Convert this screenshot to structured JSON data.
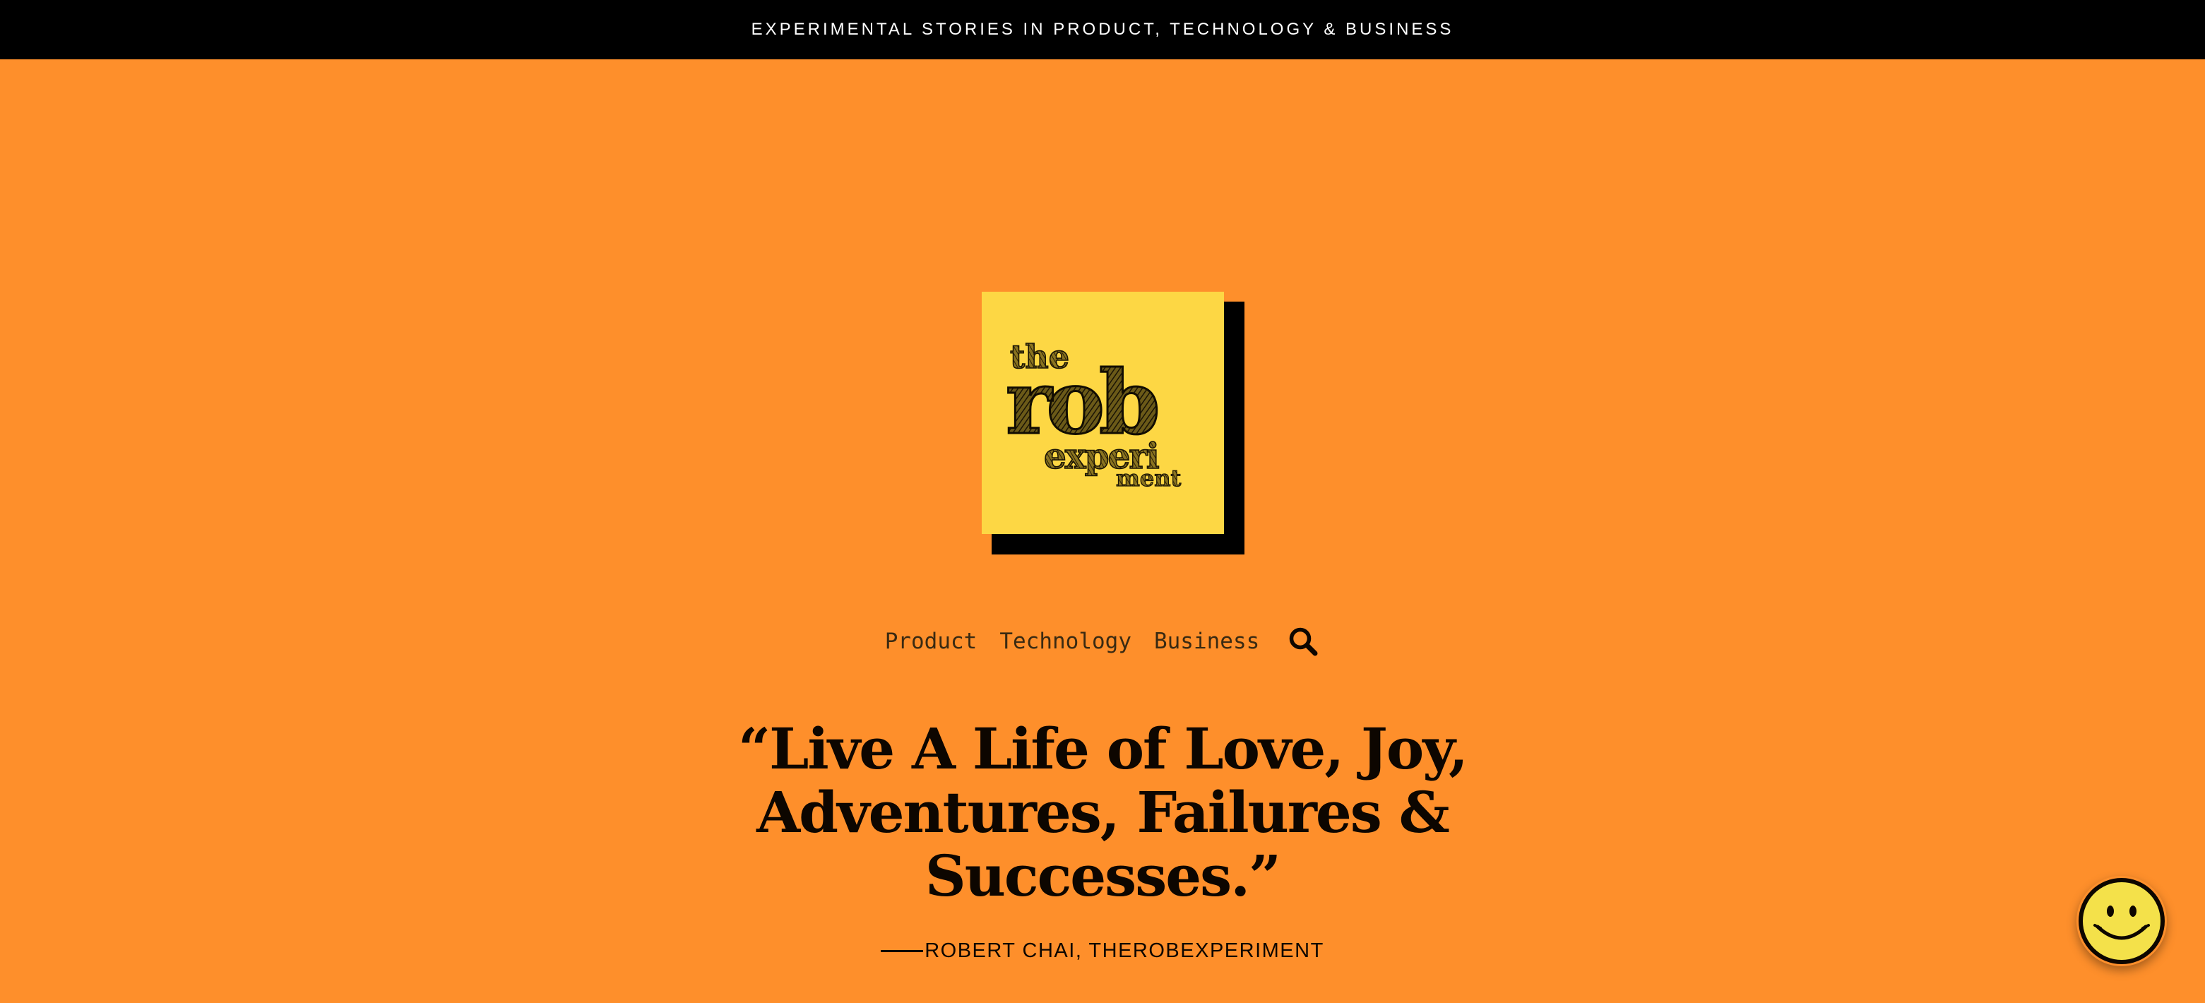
{
  "topbar": {
    "tagline": "EXPERIMENTAL STORIES IN PRODUCT, TECHNOLOGY & BUSINESS"
  },
  "logo": {
    "line1": "the",
    "line2": "rob",
    "line3": "experi",
    "line4": "ment",
    "background_color": "#fdd744",
    "shadow_color": "#000000"
  },
  "nav": {
    "items": [
      {
        "label": "Product"
      },
      {
        "label": "Technology"
      },
      {
        "label": "Business"
      }
    ],
    "search_icon": "search-icon"
  },
  "quote": {
    "text": "“Live A Life of Love, Joy, Adventures, Failures & Successes.”",
    "attribution": "ROBERT CHAI, THEROBEXPERIMENT"
  },
  "floating_button": {
    "icon": "smiley-icon",
    "color": "#f4e14a"
  },
  "colors": {
    "page_background": "#fe8f2b",
    "topbar_background": "#000000",
    "text_dark": "#0d0600"
  }
}
